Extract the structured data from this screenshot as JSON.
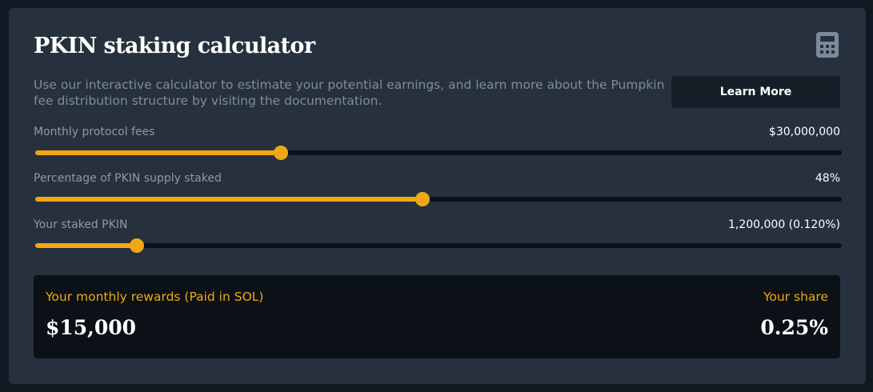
{
  "header": {
    "title": "PKIN staking calculator",
    "icon": "calculator-icon"
  },
  "intro": {
    "description": "Use our interactive calculator to estimate your potential earnings, and learn more about the Pumpkin fee distribution structure by visiting the documentation.",
    "learn_more_label": "Learn More"
  },
  "sliders": [
    {
      "label": "Monthly protocol fees",
      "value": "$30,000,000",
      "position_fraction": 0.305
    },
    {
      "label": "Percentage of PKIN supply staked",
      "value": "48%",
      "position_fraction": 0.48
    },
    {
      "label": "Your staked PKIN",
      "value": "1,200,000 (0.120%)",
      "position_fraction": 0.126
    }
  ],
  "rewards": {
    "monthly_label": "Your monthly rewards (Paid in SOL)",
    "monthly_value": "$15,000",
    "share_label": "Your share",
    "share_value": "0.25%"
  },
  "colors": {
    "accent": "#f0a814",
    "card_background": "#27313d",
    "page_background": "#111822",
    "panel_background": "#0c1117",
    "muted_text": "#8e99a8"
  }
}
